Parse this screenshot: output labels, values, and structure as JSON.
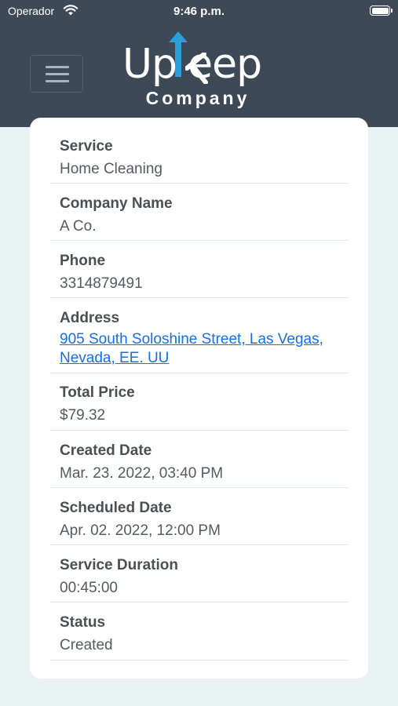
{
  "status_bar": {
    "carrier": "Operador",
    "time": "9:46 p.m."
  },
  "header": {
    "brand_main_prefix": "Up",
    "brand_main_suffix": "eep",
    "brand_sub": "Company",
    "brand_color": "#3d4957",
    "accent_color": "#2a9fd8"
  },
  "details": {
    "service": {
      "label": "Service",
      "value": "Home Cleaning"
    },
    "company_name": {
      "label": "Company Name",
      "value": "A Co."
    },
    "phone": {
      "label": "Phone",
      "value": "3314879491"
    },
    "address": {
      "label": "Address",
      "value_line1": "905 South Soloshine Street, Las Vegas,",
      "value_line2": "Nevada, EE. UU"
    },
    "total_price": {
      "label": "Total Price",
      "value": "$79.32"
    },
    "created_date": {
      "label": "Created Date",
      "value": "Mar. 23. 2022, 03:40 PM"
    },
    "scheduled_date": {
      "label": "Scheduled Date",
      "value": "Apr. 02. 2022, 12:00 PM"
    },
    "service_duration": {
      "label": "Service Duration",
      "value": "00:45:00"
    },
    "status": {
      "label": "Status",
      "value": "Created"
    }
  },
  "link_color": "#1a6fe0"
}
